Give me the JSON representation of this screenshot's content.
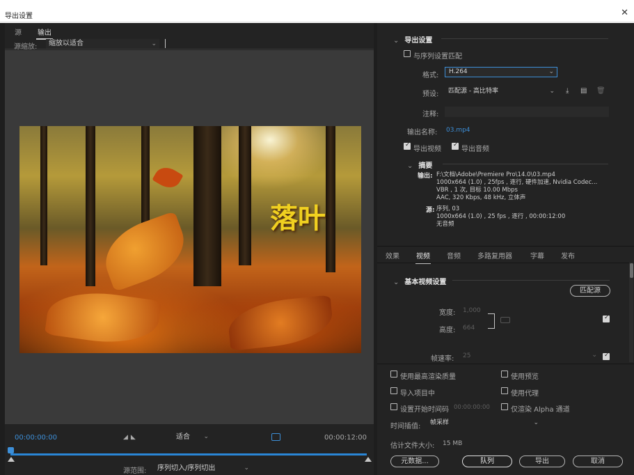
{
  "window": {
    "title": "导出设置",
    "close_glyph": "✕"
  },
  "left": {
    "tabs": [
      {
        "label": "源"
      },
      {
        "label": "输出"
      }
    ],
    "source_scale_label": "源缩放:",
    "source_scale_value": "缩放以适合",
    "overlay_text": "落叶",
    "timecode_start": "00:00:00:00",
    "timecode_end": "00:00:12:00",
    "fit_value": "适合",
    "source_range_label": "源范围:",
    "source_range_value": "序列切入/序列切出"
  },
  "export_settings": {
    "header": "导出设置",
    "match_sequence_label": "与序列设置匹配",
    "format_label": "格式:",
    "format_value": "H.264",
    "preset_label": "预设:",
    "preset_value": "匹配源 - 高比特率",
    "comment_label": "注释:",
    "comment_value": "",
    "output_name_label": "输出名称:",
    "output_name_value": "03.mp4",
    "export_video_label": "导出视频",
    "export_video_checked": true,
    "export_audio_label": "导出音频",
    "export_audio_checked": true,
    "summary": {
      "header": "摘要",
      "output_key": "输出:",
      "output_lines": [
        "F:\\文档\\Adobe\\Premiere Pro\\14.0\\03.mp4",
        "1000x664 (1.0) , 25fps , 逐行, 硬件加速, Nvidia Codec...",
        "VBR , 1 次, 目标 10.00 Mbps",
        "AAC, 320 Kbps, 48 kHz, 立体声"
      ],
      "source_key": "源:",
      "source_lines": [
        "序列, 03",
        "1000x664 (1.0) , 25 fps , 逐行 , 00:00:12:00",
        "无音频"
      ]
    }
  },
  "right_tabs": [
    {
      "label": "效果"
    },
    {
      "label": "视频"
    },
    {
      "label": "音频"
    },
    {
      "label": "多路复用器"
    },
    {
      "label": "字幕"
    },
    {
      "label": "发布"
    }
  ],
  "video_settings": {
    "header": "基本视频设置",
    "match_source_button": "匹配源",
    "width_label": "宽度:",
    "width_value": "1,000",
    "height_label": "高度:",
    "height_value": "664",
    "frame_rate_label": "帧速率:",
    "frame_rate_value": "25"
  },
  "options": {
    "max_render_quality": "使用最高渲染质量",
    "use_previews": "使用预览",
    "import_into_project": "导入项目中",
    "use_proxies": "使用代理",
    "set_start_timecode": "设置开始时间码",
    "start_timecode_value": "00:00:00:00",
    "render_alpha_only": "仅渲染 Alpha 通道",
    "time_interpolation_label": "时间插值:",
    "time_interpolation_value": "帧采样",
    "file_size_label": "估计文件大小:",
    "file_size_value": "15 MB"
  },
  "buttons": {
    "metadata": "元数据...",
    "queue": "队列",
    "export": "导出",
    "cancel": "取消"
  },
  "colors": {
    "accent": "#3d8fd8",
    "panel": "#232323",
    "preview_bg": "#3a3a3a"
  }
}
